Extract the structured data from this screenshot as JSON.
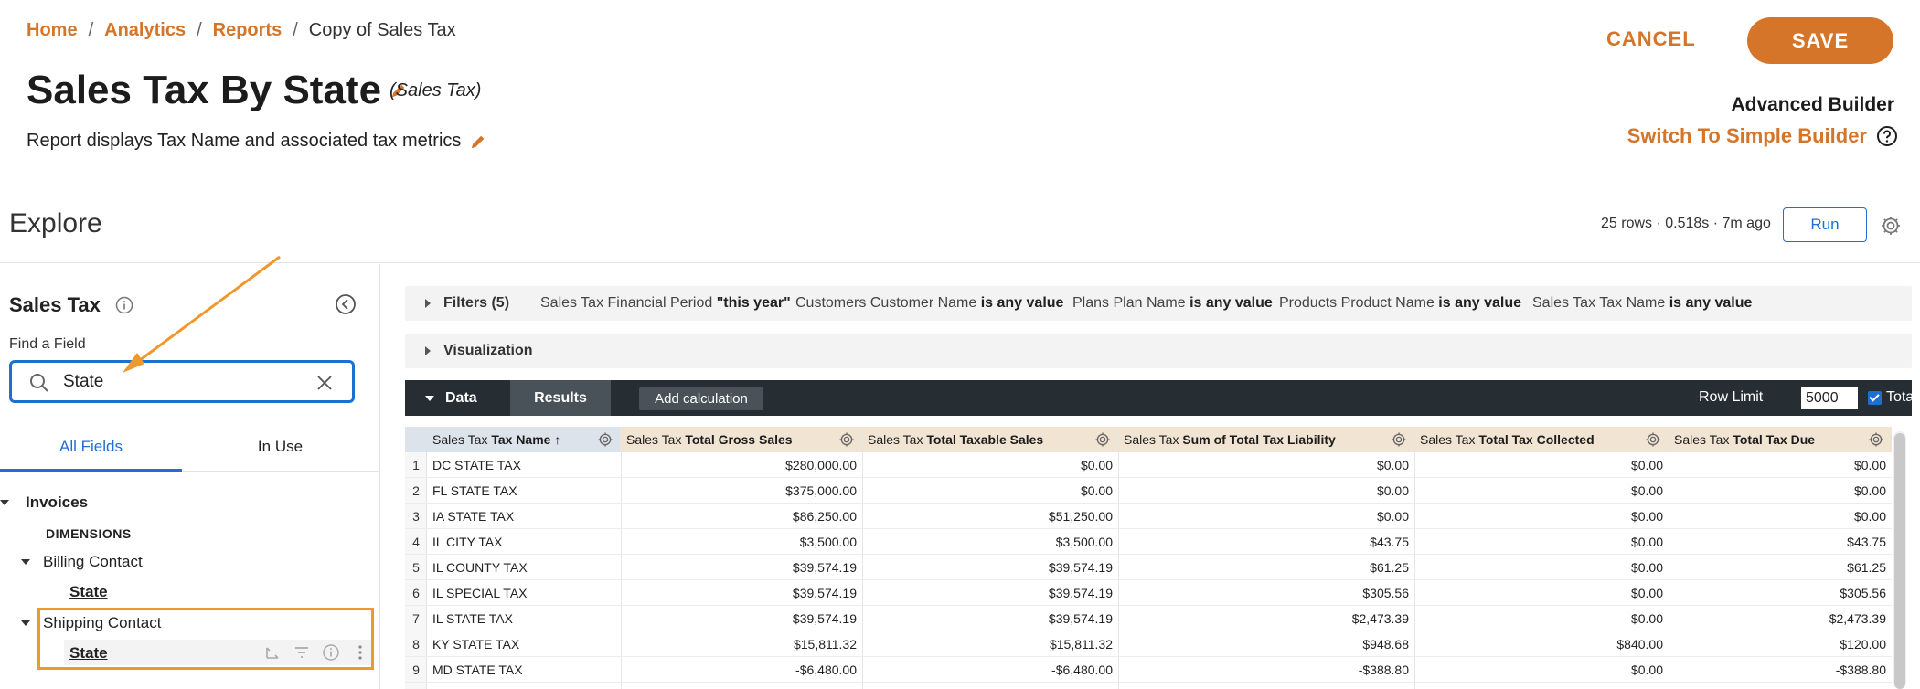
{
  "breadcrumb": {
    "items": [
      "Home",
      "Analytics",
      "Reports"
    ],
    "current": "Copy of Sales Tax"
  },
  "report": {
    "title": "Sales Tax By State",
    "source_tag": "(Sales Tax)",
    "description": "Report displays Tax Name and associated tax metrics"
  },
  "actions": {
    "cancel_label": "CANCEL",
    "save_label": "SAVE",
    "builder_mode": "Advanced Builder",
    "switch_label": "Switch To Simple Builder"
  },
  "explore": {
    "title": "Explore",
    "meta": "25 rows · 0.518s · 7m ago",
    "run_label": "Run"
  },
  "sidebar": {
    "title": "Sales Tax",
    "find_label": "Find a Field",
    "search_value": "State",
    "tabs": [
      "All Fields",
      "In Use"
    ],
    "tree": {
      "root": "Invoices",
      "dimensions_label": "DIMENSIONS",
      "groups": [
        {
          "label": "Billing Contact",
          "field": "State"
        },
        {
          "label": "Shipping Contact",
          "field": "State"
        }
      ]
    }
  },
  "filters": {
    "label": "Filters (5)",
    "items": [
      {
        "prefix": "Sales Tax Financial Period ",
        "bold": "\"this year\"",
        "suffix": ""
      },
      {
        "prefix": "Customers Customer Name ",
        "bold": "is any value",
        "suffix": ""
      },
      {
        "prefix": "Plans Plan Name ",
        "bold": "is any value",
        "suffix": ""
      },
      {
        "prefix": "Products Product Name ",
        "bold": "is any value",
        "suffix": ""
      },
      {
        "prefix": "Sales Tax Tax Name ",
        "bold": "is any value",
        "suffix": ""
      }
    ]
  },
  "visualization": {
    "label": "Visualization"
  },
  "data_bar": {
    "data_label": "Data",
    "results_label": "Results",
    "add_calc_label": "Add calculation",
    "row_limit_label": "Row Limit",
    "row_limit_value": "5000",
    "totals_label": "Totals"
  },
  "table": {
    "columns": [
      {
        "prefix": "Sales Tax ",
        "bold": "Tax Name ↑",
        "type": "dim"
      },
      {
        "prefix": "Sales Tax ",
        "bold": "Total Gross Sales",
        "type": "meas"
      },
      {
        "prefix": "Sales Tax ",
        "bold": "Total Taxable Sales",
        "type": "meas"
      },
      {
        "prefix": "Sales Tax ",
        "bold": "Sum of Total Tax Liability",
        "type": "meas"
      },
      {
        "prefix": "Sales Tax ",
        "bold": "Total Tax Collected",
        "type": "meas"
      },
      {
        "prefix": "Sales Tax ",
        "bold": "Total Tax Due",
        "type": "meas"
      }
    ],
    "rows": [
      [
        "1",
        "DC STATE TAX",
        "$280,000.00",
        "$0.00",
        "$0.00",
        "$0.00",
        "$0.00"
      ],
      [
        "2",
        "FL STATE TAX",
        "$375,000.00",
        "$0.00",
        "$0.00",
        "$0.00",
        "$0.00"
      ],
      [
        "3",
        "IA STATE TAX",
        "$86,250.00",
        "$51,250.00",
        "$0.00",
        "$0.00",
        "$0.00"
      ],
      [
        "4",
        "IL CITY TAX",
        "$3,500.00",
        "$3,500.00",
        "$43.75",
        "$0.00",
        "$43.75"
      ],
      [
        "5",
        "IL COUNTY TAX",
        "$39,574.19",
        "$39,574.19",
        "$61.25",
        "$0.00",
        "$61.25"
      ],
      [
        "6",
        "IL SPECIAL TAX",
        "$39,574.19",
        "$39,574.19",
        "$305.56",
        "$0.00",
        "$305.56"
      ],
      [
        "7",
        "IL STATE TAX",
        "$39,574.19",
        "$39,574.19",
        "$2,473.39",
        "$0.00",
        "$2,473.39"
      ],
      [
        "8",
        "KY STATE TAX",
        "$15,811.32",
        "$15,811.32",
        "$948.68",
        "$840.00",
        "$120.00"
      ],
      [
        "9",
        "MD STATE TAX",
        "-$6,480.00",
        "-$6,480.00",
        "-$388.80",
        "$0.00",
        "-$388.80"
      ]
    ]
  },
  "colors": {
    "accent": "#d4752a",
    "link_blue": "#1f6fd0",
    "dark_bar": "#262d33",
    "highlight": "#f0982e"
  },
  "icons": [
    "pencil-icon",
    "help-icon",
    "gear-icon",
    "info-icon",
    "collapse-icon",
    "search-icon",
    "clear-icon",
    "caret-down-icon",
    "pivot-icon",
    "filter-icon",
    "more-icon"
  ]
}
